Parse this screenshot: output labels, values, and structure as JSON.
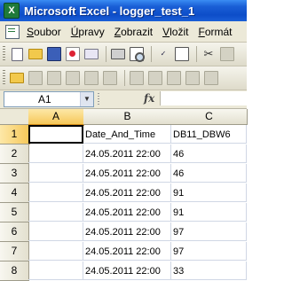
{
  "window": {
    "title": "Microsoft Excel - logger_test_1"
  },
  "menu": {
    "items": [
      {
        "label": "Soubor",
        "key": "S",
        "rest": "oubor"
      },
      {
        "label": "Úpravy",
        "key": "Ú",
        "rest": "pravy"
      },
      {
        "label": "Zobrazit",
        "key": "Z",
        "rest": "obrazit"
      },
      {
        "label": "Vložit",
        "key": "V",
        "rest": "ložit"
      },
      {
        "label": "Formát",
        "key": "F",
        "rest": "ormát"
      }
    ]
  },
  "formula_bar": {
    "name_box": "A1",
    "fx_label": "fx",
    "formula": ""
  },
  "sheet": {
    "columns": [
      "A",
      "B",
      "C"
    ],
    "rows": [
      {
        "num": "1",
        "a": "",
        "b": "Date_And_Time",
        "c": "DB11_DBW6"
      },
      {
        "num": "2",
        "a": "",
        "b": "24.05.2011 22:00",
        "c": "46"
      },
      {
        "num": "3",
        "a": "",
        "b": "24.05.2011 22:00",
        "c": "46"
      },
      {
        "num": "4",
        "a": "",
        "b": "24.05.2011 22:00",
        "c": "91"
      },
      {
        "num": "5",
        "a": "",
        "b": "24.05.2011 22:00",
        "c": "91"
      },
      {
        "num": "6",
        "a": "",
        "b": "24.05.2011 22:00",
        "c": "97"
      },
      {
        "num": "7",
        "a": "",
        "b": "24.05.2011 22:00",
        "c": "97"
      },
      {
        "num": "8",
        "a": "",
        "b": "24.05.2011 22:00",
        "c": "33"
      }
    ],
    "active_cell": "A1"
  }
}
